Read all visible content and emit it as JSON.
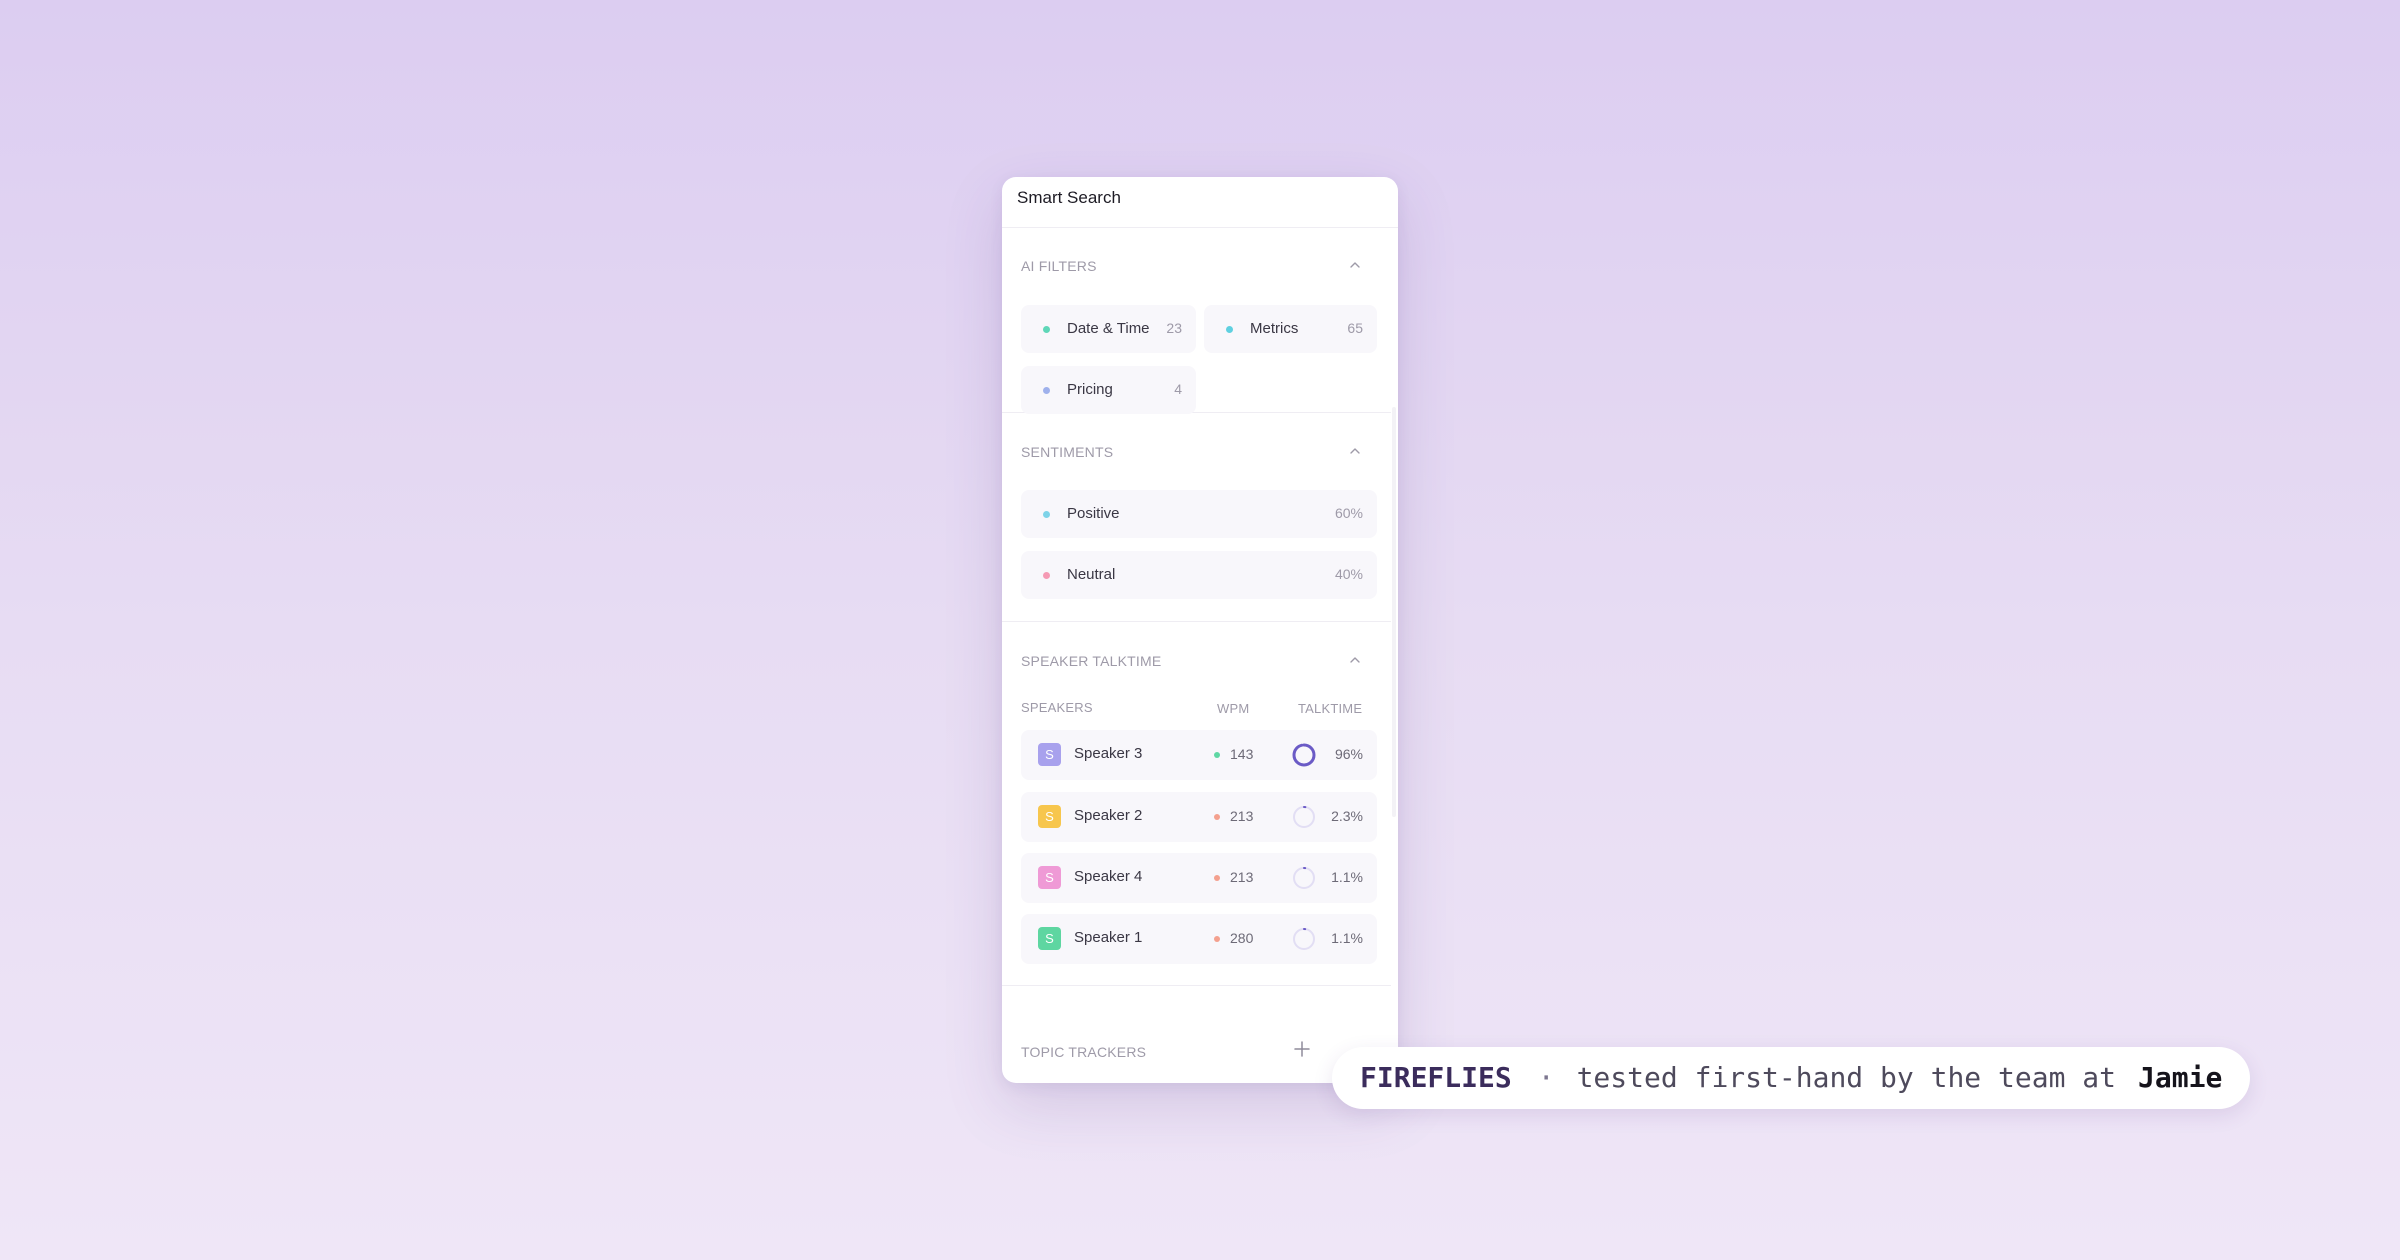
{
  "panel": {
    "title": "Smart Search"
  },
  "ai_filters": {
    "heading": "AI FILTERS",
    "items": [
      {
        "label": "Date & Time",
        "count": "23",
        "dot_color": "#5fd7b8"
      },
      {
        "label": "Metrics",
        "count": "65",
        "dot_color": "#5fd0e0"
      },
      {
        "label": "Pricing",
        "count": "4",
        "dot_color": "#9fb1ec"
      }
    ]
  },
  "sentiments": {
    "heading": "SENTIMENTS",
    "items": [
      {
        "label": "Positive",
        "value": "60%",
        "dot_color": "#7ed3e8"
      },
      {
        "label": "Neutral",
        "value": "40%",
        "dot_color": "#f59ab4"
      }
    ]
  },
  "speaker_talktime": {
    "heading": "SPEAKER TALKTIME",
    "columns": [
      "SPEAKERS",
      "WPM",
      "TALKTIME"
    ],
    "rows": [
      {
        "initial": "S",
        "name": "Speaker 3",
        "wpm": "143",
        "talktime": "96%",
        "talktime_fraction": 0.96,
        "avatar_color": "#a8a1ed",
        "wpm_dot_color": "#5fd7a4"
      },
      {
        "initial": "S",
        "name": "Speaker 2",
        "wpm": "213",
        "talktime": "2.3%",
        "talktime_fraction": 0.023,
        "avatar_color": "#f7c64d",
        "wpm_dot_color": "#f4a08e"
      },
      {
        "initial": "S",
        "name": "Speaker 4",
        "wpm": "213",
        "talktime": "1.1%",
        "talktime_fraction": 0.011,
        "avatar_color": "#ef9ad6",
        "wpm_dot_color": "#f4a08e"
      },
      {
        "initial": "S",
        "name": "Speaker 1",
        "wpm": "280",
        "talktime": "1.1%",
        "talktime_fraction": 0.011,
        "avatar_color": "#5ed6a1",
        "wpm_dot_color": "#f4a08e"
      }
    ]
  },
  "topic_trackers": {
    "heading": "TOPIC TRACKERS"
  },
  "caption": {
    "brand": "FIREFLIES",
    "separator": "·",
    "tagline": "tested first-hand by the team at",
    "team": "Jamie"
  },
  "colors": {
    "accent": "#6b5bc6",
    "ring_track": "#e2def4"
  },
  "icons": {
    "section_toggle": "chevron-up-icon",
    "add": "plus-icon"
  }
}
